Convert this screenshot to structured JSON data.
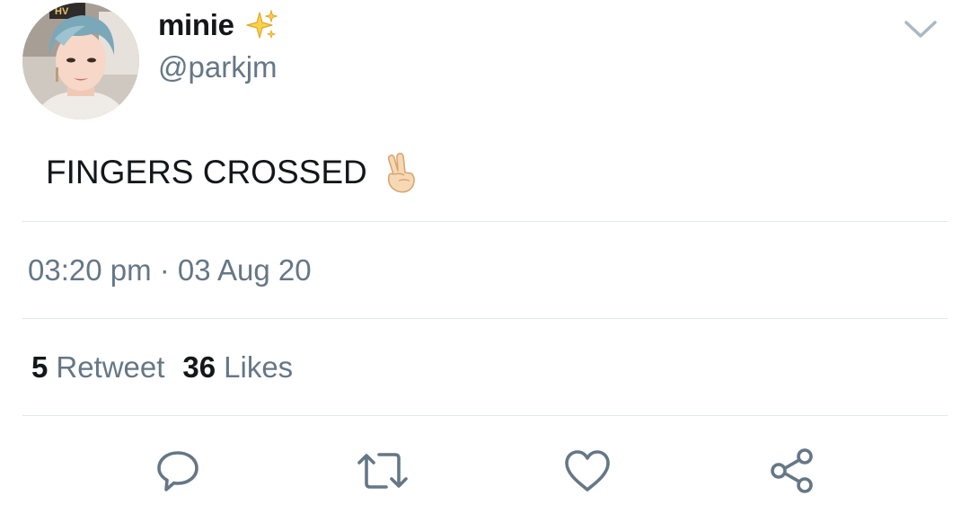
{
  "author": {
    "display_name": "minie",
    "name_emoji": "sparkles-icon",
    "handle": "@parkjm",
    "avatar": "profile-photo"
  },
  "tweet": {
    "text": "FINGERS CROSSED",
    "text_emoji": "crossed-fingers-icon",
    "timestamp": "03:20 pm · 03 Aug 20"
  },
  "stats": {
    "retweets": {
      "count": "5",
      "label": "Retweet"
    },
    "likes": {
      "count": "36",
      "label": "Likes"
    }
  },
  "actions": [
    "reply-icon",
    "retweet-icon",
    "like-icon",
    "share-icon"
  ],
  "colors": {
    "primary_text": "#14171a",
    "secondary_text": "#657786",
    "divider": "#e1e8ed",
    "icon": "#657786"
  }
}
